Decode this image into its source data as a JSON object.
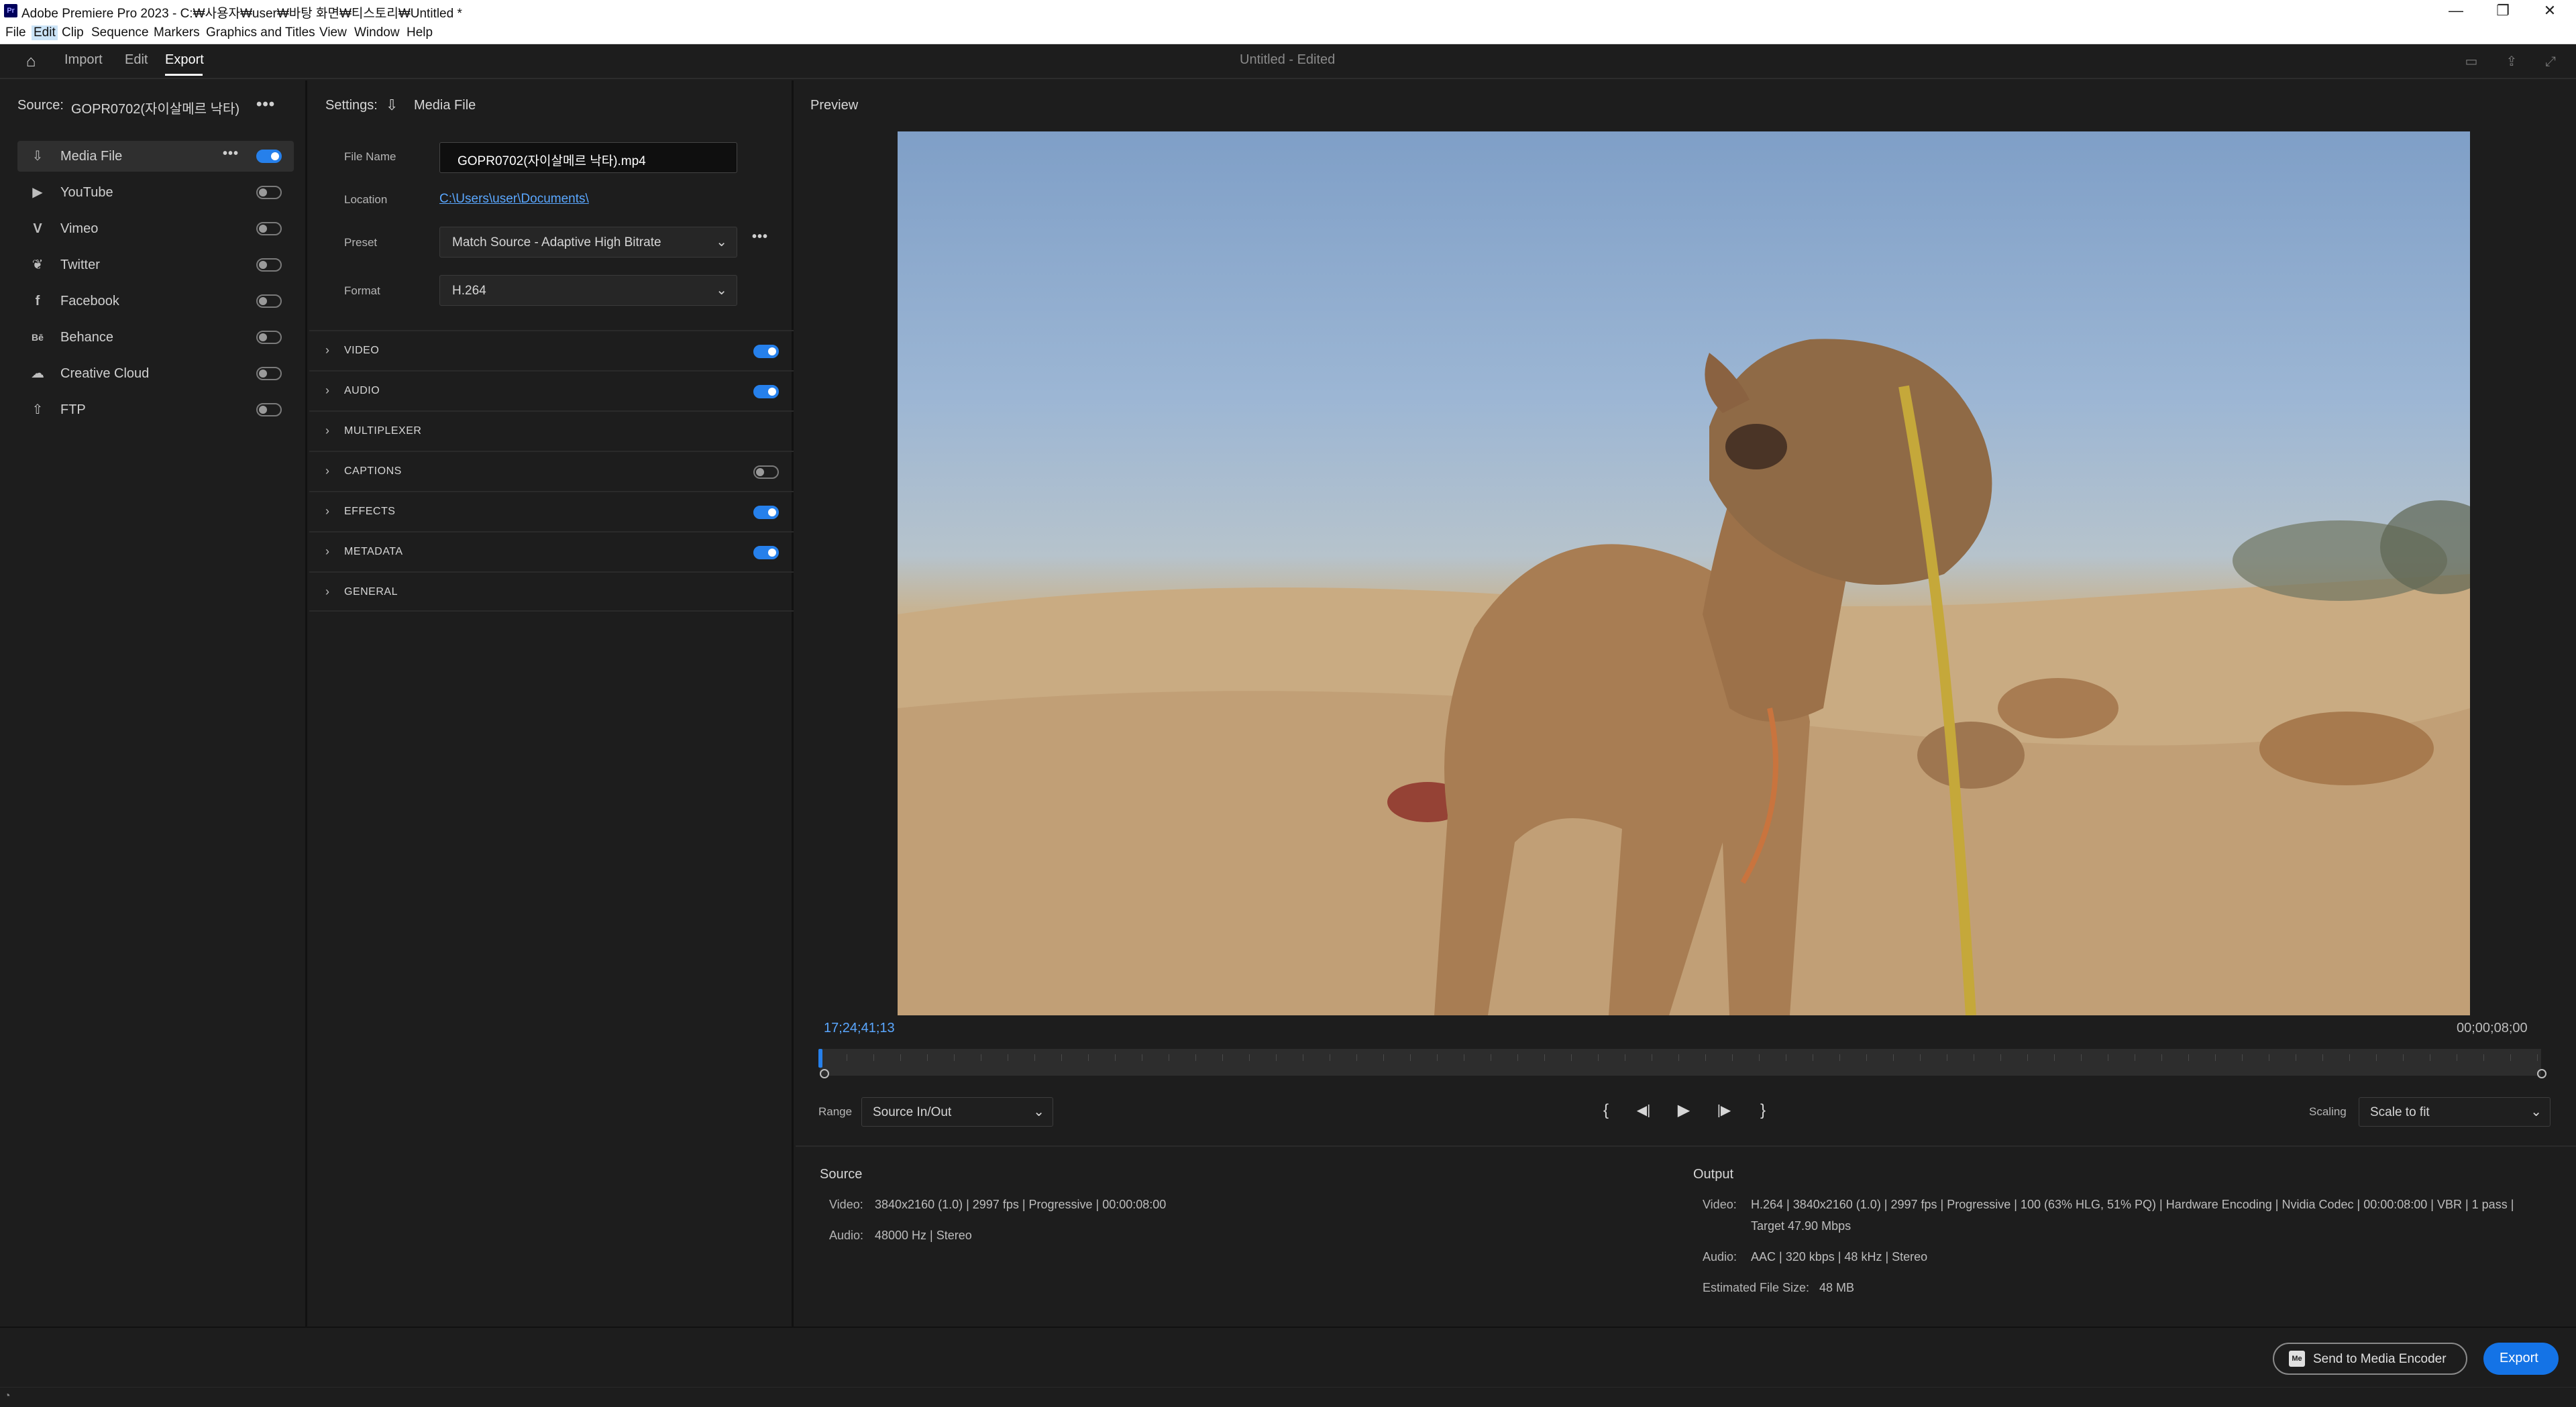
{
  "window": {
    "app_logo": "Pr",
    "title": "Adobe Premiere Pro 2023 - C:₩사용자₩user₩바탕 화면₩티스토리₩Untitled *",
    "minimize": "—",
    "restore": "❐",
    "close": "✕"
  },
  "menu": [
    "File",
    "Edit",
    "Clip",
    "Sequence",
    "Markers",
    "Graphics and Titles",
    "View",
    "Window",
    "Help"
  ],
  "header": {
    "tabs": [
      "Import",
      "Edit",
      "Export"
    ],
    "active_tab": "Export",
    "doc_title": "Untitled - Edited"
  },
  "source": {
    "label": "Source:",
    "name": "GOPR0702(자이살메르 낙타)",
    "more": "•••"
  },
  "destinations": [
    {
      "label": "Media File",
      "icon": "download-icon",
      "glyph": "⇩",
      "on": true
    },
    {
      "label": "YouTube",
      "icon": "youtube-icon",
      "glyph": "▶",
      "on": false
    },
    {
      "label": "Vimeo",
      "icon": "vimeo-icon",
      "glyph": "V",
      "on": false
    },
    {
      "label": "Twitter",
      "icon": "twitter-icon",
      "glyph": "🐦",
      "on": false
    },
    {
      "label": "Facebook",
      "icon": "facebook-icon",
      "glyph": "f",
      "on": false
    },
    {
      "label": "Behance",
      "icon": "behance-icon",
      "glyph": "Bē",
      "on": false
    },
    {
      "label": "Creative Cloud",
      "icon": "creative-cloud-icon",
      "glyph": "☁",
      "on": false
    },
    {
      "label": "FTP",
      "icon": "upload-icon",
      "glyph": "⇧",
      "on": false
    }
  ],
  "settings": {
    "label": "Settings:",
    "target": "Media File",
    "file_name_label": "File Name",
    "file_name": "GOPR0702(자이살메르 낙타).mp4",
    "location_label": "Location",
    "location": "C:\\Users\\user\\Documents\\",
    "preset_label": "Preset",
    "preset": "Match Source - Adaptive High Bitrate",
    "format_label": "Format",
    "format": "H.264",
    "sections": [
      {
        "name": "VIDEO",
        "toggle": true,
        "on": true
      },
      {
        "name": "AUDIO",
        "toggle": true,
        "on": true
      },
      {
        "name": "MULTIPLEXER",
        "toggle": false,
        "on": false
      },
      {
        "name": "CAPTIONS",
        "toggle": true,
        "on": false
      },
      {
        "name": "EFFECTS",
        "toggle": true,
        "on": true
      },
      {
        "name": "METADATA",
        "toggle": true,
        "on": true
      },
      {
        "name": "GENERAL",
        "toggle": false,
        "on": false
      }
    ]
  },
  "preview": {
    "title": "Preview",
    "timecode_current": "17;24;41;13",
    "timecode_duration": "00;00;08;00",
    "range_label": "Range",
    "range": "Source In/Out",
    "scaling_label": "Scaling",
    "scaling": "Scale to fit",
    "transport": [
      "{",
      "◀|",
      "▶",
      "|▶",
      "}"
    ]
  },
  "summary": {
    "source_title": "Source",
    "source": [
      {
        "k": "Video:",
        "v": "3840x2160 (1.0)  |  2997 fps  |  Progressive  |  00:00:08:00"
      },
      {
        "k": "Audio:",
        "v": "48000 Hz  |  Stereo"
      }
    ],
    "output_title": "Output",
    "output_video_k": "Video:",
    "output_video_1": "H.264  |  3840x2160 (1.0)  |  2997 fps  |  Progressive  |  100 (63% HLG, 51% PQ)  |  Hardware Encoding  |  Nvidia Codec  |  00:00:08:00  |  VBR  |  1 pass  |",
    "output_video_2": "Target 47.90 Mbps",
    "output_audio_k": "Audio:",
    "output_audio": "AAC  |  320 kbps  |  48 kHz  |  Stereo",
    "size_k": "Estimated File Size:",
    "size_v": "48 MB"
  },
  "buttons": {
    "send_to_encoder": "Send to Media Encoder",
    "export": "Export"
  }
}
